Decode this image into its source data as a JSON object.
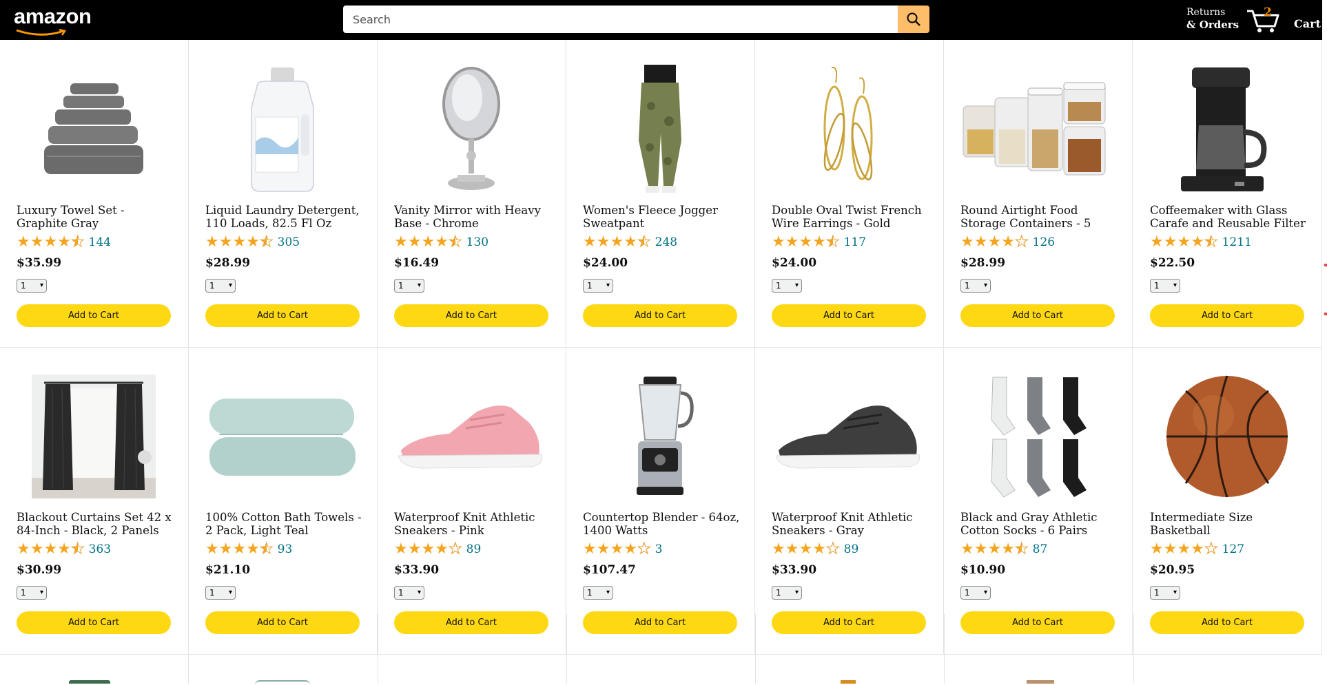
{
  "header": {
    "logo_text": "amazon",
    "search_placeholder": "Search",
    "returns_line1": "Returns",
    "returns_line2": "& Orders",
    "cart_count": "2",
    "cart_label": "Cart"
  },
  "add_to_cart_label": "Add to Cart",
  "qty_default": "1",
  "colors": {
    "star": "#f4a41f",
    "star_empty": "#e9a23b",
    "button": "#ffd814",
    "link": "#007185",
    "header_bg": "#000000",
    "search_button": "#febd69"
  },
  "products": [
    {
      "title": "Luxury Towel Set - Graphite Gray",
      "rating": 4.5,
      "reviews": "144",
      "price": "$35.99",
      "image_icon": "towel-set-icon"
    },
    {
      "title": "Liquid Laundry Detergent, 110 Loads, 82.5 Fl Oz",
      "rating": 4.5,
      "reviews": "305",
      "price": "$28.99",
      "image_icon": "detergent-bottle-icon"
    },
    {
      "title": "Vanity Mirror with Heavy Base - Chrome",
      "rating": 4.5,
      "reviews": "130",
      "price": "$16.49",
      "image_icon": "vanity-mirror-icon"
    },
    {
      "title": "Women's Fleece Jogger Sweatpant",
      "rating": 4.5,
      "reviews": "248",
      "price": "$24.00",
      "image_icon": "jogger-pants-icon"
    },
    {
      "title": "Double Oval Twist French Wire Earrings - Gold",
      "rating": 4.5,
      "reviews": "117",
      "price": "$24.00",
      "image_icon": "earrings-icon"
    },
    {
      "title": "Round Airtight Food Storage Containers - 5",
      "rating": 4,
      "reviews": "126",
      "price": "$28.99",
      "image_icon": "food-containers-icon"
    },
    {
      "title": "Coffeemaker with Glass Carafe and Reusable Filter",
      "rating": 4.5,
      "reviews": "1211",
      "price": "$22.50",
      "image_icon": "coffeemaker-icon"
    },
    {
      "title": "Blackout Curtains Set 42 x 84-Inch - Black, 2 Panels",
      "rating": 4.5,
      "reviews": "363",
      "price": "$30.99",
      "image_icon": "curtains-icon"
    },
    {
      "title": "100% Cotton Bath Towels - 2 Pack, Light Teal",
      "rating": 4.5,
      "reviews": "93",
      "price": "$21.10",
      "image_icon": "bath-towels-icon"
    },
    {
      "title": "Waterproof Knit Athletic Sneakers - Pink",
      "rating": 4,
      "reviews": "89",
      "price": "$33.90",
      "image_icon": "pink-sneaker-icon"
    },
    {
      "title": "Countertop Blender - 64oz, 1400 Watts",
      "rating": 4,
      "reviews": "3",
      "price": "$107.47",
      "image_icon": "blender-icon"
    },
    {
      "title": "Waterproof Knit Athletic Sneakers - Gray",
      "rating": 4,
      "reviews": "89",
      "price": "$33.90",
      "image_icon": "gray-sneaker-icon"
    },
    {
      "title": "Black and Gray Athletic Cotton Socks - 6 Pairs",
      "rating": 4.5,
      "reviews": "87",
      "price": "$10.90",
      "image_icon": "socks-icon"
    },
    {
      "title": "Intermediate Size Basketball",
      "rating": 4,
      "reviews": "127",
      "price": "$20.95",
      "image_icon": "basketball-icon"
    }
  ]
}
